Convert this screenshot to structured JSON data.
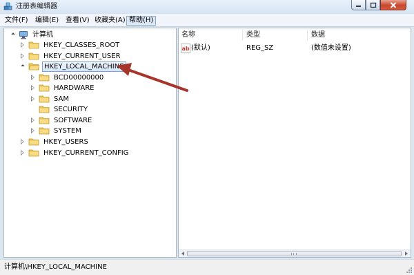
{
  "window": {
    "title": "注册表编辑器",
    "icon": "registry-editor-icon"
  },
  "menu": [
    {
      "label": "文件(F)"
    },
    {
      "label": "编辑(E)"
    },
    {
      "label": "查看(V)"
    },
    {
      "label": "收藏夹(A)"
    },
    {
      "label": "帮助(H)",
      "active": true
    }
  ],
  "tree": {
    "root": "计算机",
    "items": [
      {
        "label": "HKEY_CLASSES_ROOT",
        "expanded": false
      },
      {
        "label": "HKEY_CURRENT_USER",
        "expanded": false
      },
      {
        "label": "HKEY_LOCAL_MACHINE",
        "expanded": true,
        "selected": true,
        "children": [
          {
            "label": "BCD00000000",
            "has_children": true
          },
          {
            "label": "HARDWARE",
            "has_children": true
          },
          {
            "label": "SAM",
            "has_children": true
          },
          {
            "label": "SECURITY",
            "has_children": false
          },
          {
            "label": "SOFTWARE",
            "has_children": true
          },
          {
            "label": "SYSTEM",
            "has_children": true
          }
        ]
      },
      {
        "label": "HKEY_USERS",
        "expanded": false
      },
      {
        "label": "HKEY_CURRENT_CONFIG",
        "expanded": false
      }
    ]
  },
  "list": {
    "columns": [
      "名称",
      "类型",
      "数据"
    ],
    "rows": [
      {
        "name": "(默认)",
        "type": "REG_SZ",
        "data": "(数值未设置)",
        "icon": "string-value-icon"
      }
    ]
  },
  "status": {
    "path": "计算机\\HKEY_LOCAL_MACHINE"
  },
  "colors": {
    "arrow": "#a8352b",
    "selection": "#d6e6f8",
    "folder": "#e9c25a"
  }
}
